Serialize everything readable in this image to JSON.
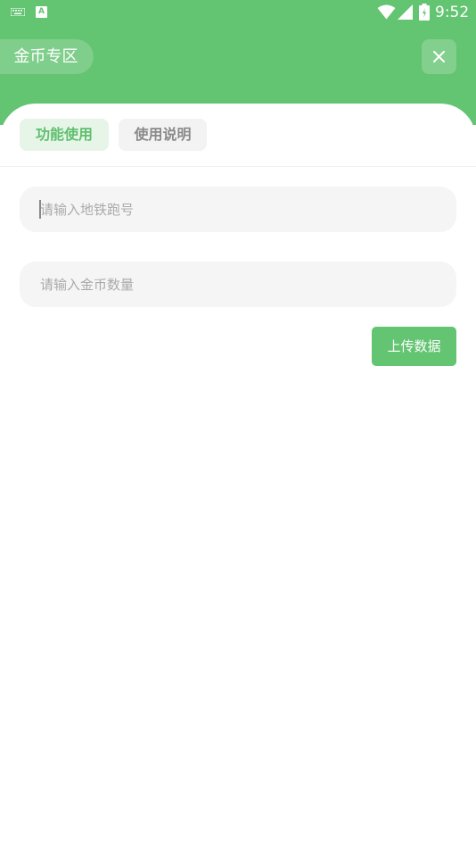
{
  "status_bar": {
    "time": "9:52",
    "icons": [
      "keyboard-icon",
      "a-icon",
      "wifi-icon",
      "signal-icon",
      "battery-icon"
    ]
  },
  "header": {
    "title": "金币专区",
    "close_icon": "close-icon"
  },
  "tabs": [
    {
      "label": "功能使用",
      "active": true
    },
    {
      "label": "使用说明",
      "active": false
    }
  ],
  "form": {
    "subway_number": {
      "placeholder": "请输入地铁跑号",
      "value": ""
    },
    "coin_amount": {
      "placeholder": "请输入金币数量",
      "value": ""
    },
    "upload_label": "上传数据"
  },
  "colors": {
    "primary": "#63c472",
    "tab_active_bg": "#e6f5e8",
    "input_bg": "#f5f5f5"
  }
}
